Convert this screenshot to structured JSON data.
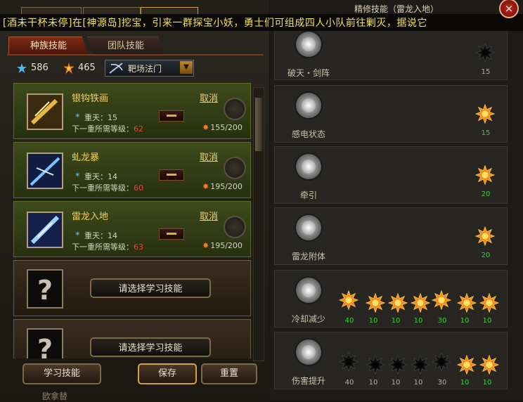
{
  "marquee": "[酒未干杯未停]在[神源岛]挖宝，引来一群探宝小妖，勇士们可组成四人小队前往剿灭，据说它",
  "tabs": {
    "race": "种族技能",
    "team": "团队技能"
  },
  "resources": {
    "points_a": "586",
    "points_b": "465"
  },
  "select": {
    "label": "靶场法门"
  },
  "skills": [
    {
      "name": "银钩铁画",
      "cancel": "取消",
      "level_label": "重天：",
      "level": "15",
      "next_label": "下一重所需等级：",
      "next_level": "62",
      "progress": "155/200"
    },
    {
      "name": "虬龙暴",
      "cancel": "取消",
      "level_label": "重天：",
      "level": "14",
      "next_label": "下一重所需等级：",
      "next_level": "60",
      "progress": "195/200"
    },
    {
      "name": "雷龙入地",
      "cancel": "取消",
      "level_label": "重天：",
      "level": "14",
      "next_label": "下一重所需等级：",
      "next_level": "63",
      "progress": "195/200"
    }
  ],
  "empty_slots": [
    {
      "label": "请选择学习技能"
    },
    {
      "label": "请选择学习技能"
    }
  ],
  "buttons": {
    "learn": "学习技能",
    "save": "保存",
    "reset": "重置"
  },
  "footer": "欧拿替",
  "right_panel": {
    "title": "精修技能（雷龙入地）",
    "close": "×",
    "rows": [
      {
        "label": "破天・剑阵",
        "nodes": [
          {
            "active": false,
            "value": "15"
          }
        ]
      },
      {
        "label": "感电状态",
        "nodes": [
          {
            "active": true,
            "value": "15"
          }
        ]
      },
      {
        "label": "牵引",
        "nodes": [
          {
            "active": true,
            "value": "20"
          }
        ]
      },
      {
        "label": "雷龙附体",
        "nodes": [
          {
            "active": true,
            "value": "20"
          }
        ]
      },
      {
        "label": "冷却减少",
        "nodes": [
          {
            "active": true,
            "value": "40"
          },
          {
            "active": true,
            "value": "10"
          },
          {
            "active": true,
            "value": "10"
          },
          {
            "active": true,
            "value": "10"
          },
          {
            "active": true,
            "value": "30"
          },
          {
            "active": true,
            "value": "10"
          },
          {
            "active": true,
            "value": "10"
          }
        ]
      },
      {
        "label": "伤害提升",
        "nodes": [
          {
            "active": false,
            "value": "40"
          },
          {
            "active": false,
            "value": "10"
          },
          {
            "active": false,
            "value": "10"
          },
          {
            "active": false,
            "value": "10"
          },
          {
            "active": false,
            "value": "30"
          },
          {
            "active": true,
            "value": "10"
          },
          {
            "active": true,
            "value": "10"
          }
        ]
      }
    ]
  },
  "colors": {
    "active_value": "#38d038",
    "inactive_value": "#b8b0a0",
    "accent": "#f08020"
  }
}
